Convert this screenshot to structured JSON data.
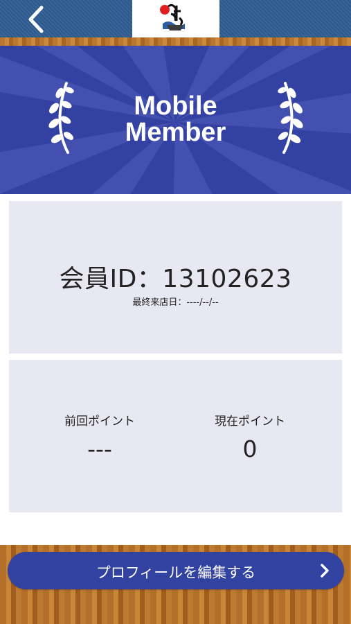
{
  "header": {
    "back_icon": "chevron-left-icon",
    "logo": "brand-logo"
  },
  "hero": {
    "title_line1": "Mobile",
    "title_line2": "Member"
  },
  "member": {
    "id_text": "会員ID：13102623",
    "last_visit": "最終来店日：----/--/--"
  },
  "points": {
    "previous_label": "前回ポイント",
    "previous_value": "---",
    "current_label": "現在ポイント",
    "current_value": "0"
  },
  "edit_profile": {
    "label": "プロフィールを編集する",
    "icon": "chevron-right-icon"
  },
  "colors": {
    "primary": "#3341a3",
    "panel": "#e8e8f2",
    "header": "#2f5d93",
    "wood": "#b46f2a"
  }
}
